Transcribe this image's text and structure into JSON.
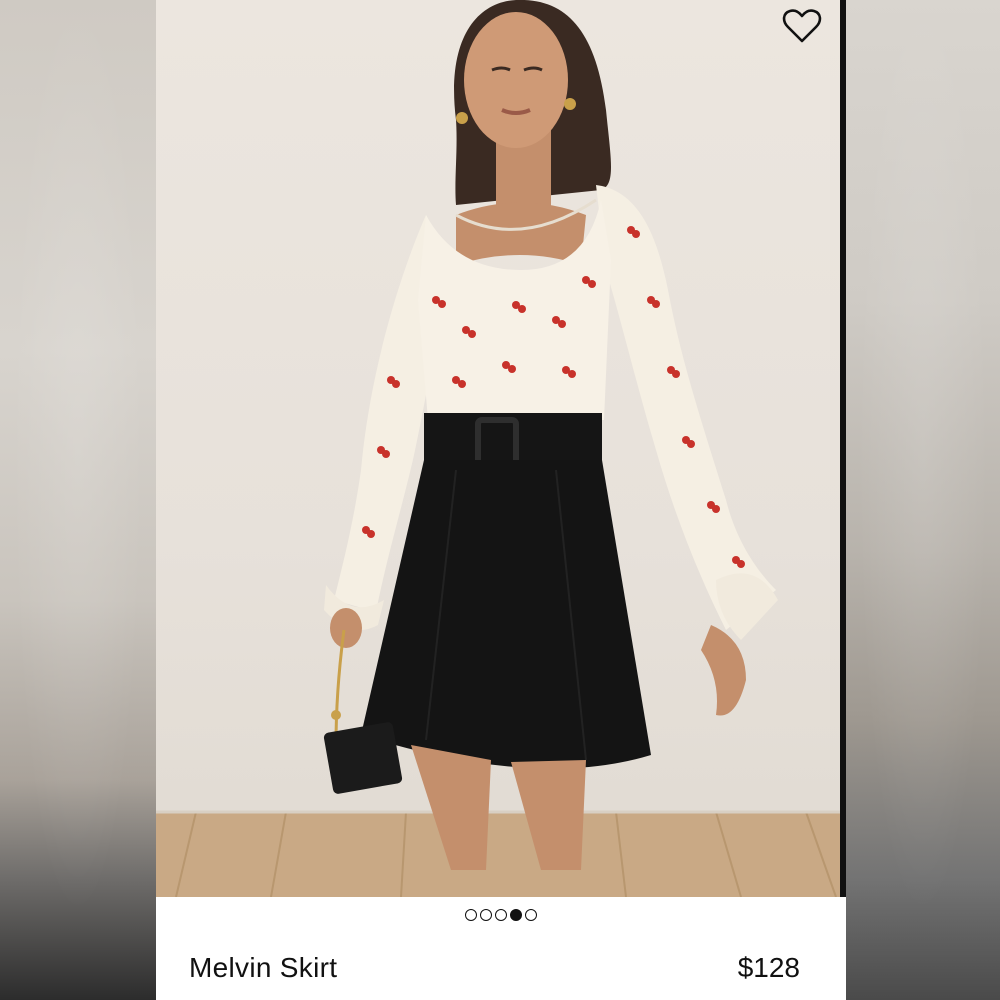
{
  "product": {
    "name": "Melvin Skirt",
    "price": "$128"
  },
  "gallery": {
    "image_count": 5,
    "active_index": 3
  },
  "icons": {
    "favorite": "heart-outline-icon"
  },
  "colors": {
    "text": "#111111",
    "background": "#ffffff"
  }
}
